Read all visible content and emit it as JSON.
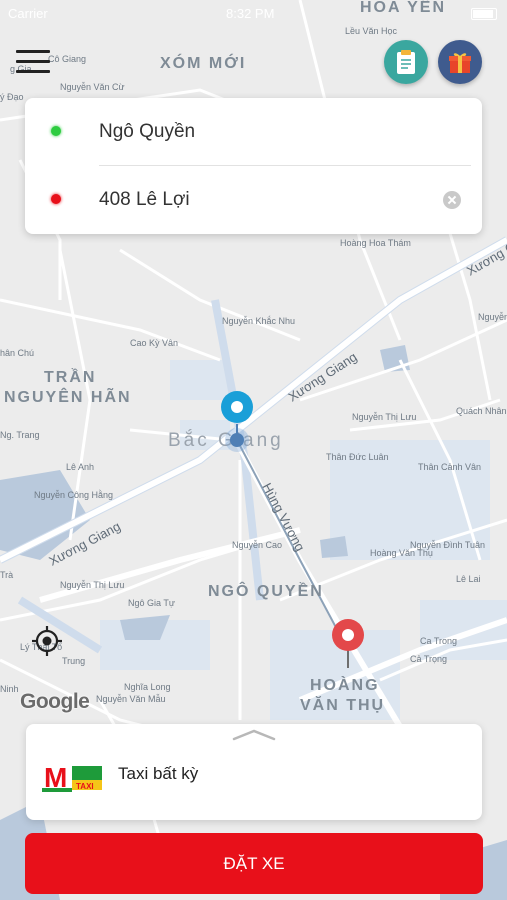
{
  "status_bar": {
    "carrier": "Carrier",
    "time": "8:32 PM"
  },
  "header": {
    "menu_icon": "hamburger-menu-icon",
    "orders_icon": "clipboard-icon",
    "gifts_icon": "gift-icon"
  },
  "route": {
    "pickup": {
      "address": "Ngô Quyền",
      "dot_color": "#2ecc40"
    },
    "dropoff": {
      "address": "408 Lê Lợi",
      "dot_color": "#e8101a"
    }
  },
  "map": {
    "districts": {
      "xom_moi": "XÓM MỚI",
      "hoa_yen": "HOA YÊN",
      "tran": "TRẦN",
      "nguyen_han": "NGUYÊN HÃN",
      "ngo_quyen": "NGÔ QUYỀN",
      "hoang": "HOÀNG",
      "van_thu": "VĂN THỤ"
    },
    "city": "Bắc Giang",
    "streets": {
      "co_giang": "Cô Giang",
      "gia": "g Gia",
      "nguyen_van_cu": "Nguyễn Văn Cừ",
      "ly_dao": "ý Đạo",
      "leu_van_hoc": "Lều Văn Học",
      "hoang_hoa_tham": "Hoàng Hoa Thám",
      "cao_ky_van": "Cao Kỳ Vân",
      "nguyen_khac_nhu": "Nguyễn Khắc Nhu",
      "nhan_chu": "hân Chú",
      "xuong_giang": "Xương Giang",
      "nguyen_thi_luu": "Nguyễn Thị Lưu",
      "than_duc_luan": "Thân Đức Luân",
      "quach_nhan": "Quách Nhân",
      "nguyen_tu": "Nguyễn Tú",
      "ngo_trang": "Ng. Trang",
      "le_anh": "Lê Anh",
      "nguyen_cong_hang": "Nguyễn Công Hằng",
      "nguyen_cao": "Nguyễn Cao",
      "hung_vuong": "Hùng Vương",
      "than_canh_van": "Thân Cảnh Vân",
      "ngo_gia_tu": "Ngô Gia Tự",
      "hoang_van_thu": "Hoàng Văn Thụ",
      "nguyen_dinh_tuan": "Nguyễn Đình Tuân",
      "le_lai": "Lê Lai",
      "ly_thai_to": "Lý Thái Tổ",
      "trung": "Trung",
      "nghia_long": "Nghĩa Long",
      "ca_trong": "Ca Trong",
      "ca_trong2": "Cả Trọng",
      "nguyen_van_mau": "Nguyễn Văn Mẫu",
      "tra": "Trà",
      "ninh": "Ninh"
    },
    "attribution": "Google"
  },
  "taxi": {
    "label": "Taxi bất kỳ",
    "logo_letter": "M",
    "logo_text": "TAXI"
  },
  "actions": {
    "book_label": "ĐẶT XE"
  },
  "colors": {
    "accent": "#e8101a",
    "pickup_pin": "#1a9fd8",
    "dropoff_pin": "#e3484a",
    "orders_btn": "#3aa79f",
    "gifts_btn": "#3f5b8e"
  }
}
